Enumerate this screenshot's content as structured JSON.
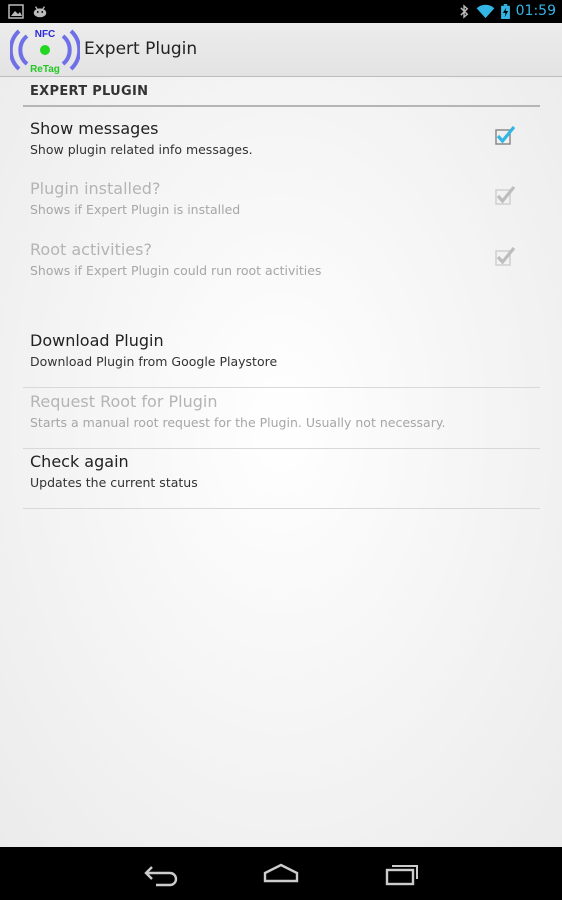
{
  "status_bar": {
    "time": "01:59",
    "icons": [
      "image-notification-icon",
      "android-notification-icon",
      "bluetooth-icon",
      "wifi-icon",
      "battery-icon"
    ],
    "accent": "#33b5e5"
  },
  "action_bar": {
    "app_icon_text_top": "NFC",
    "app_icon_text_bottom": "ReTag",
    "title": "Expert Plugin"
  },
  "preferences": {
    "category": "EXPERT PLUGIN",
    "items": [
      {
        "title": "Show messages",
        "summary": "Show plugin related info messages.",
        "checked": true,
        "enabled": true
      },
      {
        "title": "Plugin installed?",
        "summary": "Shows if Expert Plugin is installed",
        "checked": true,
        "enabled": false
      },
      {
        "title": "Root activities?",
        "summary": "Shows if Expert Plugin could run root activities",
        "checked": true,
        "enabled": false
      },
      {
        "title": "Download Plugin",
        "summary": "Download Plugin from Google Playstore",
        "enabled": true
      },
      {
        "title": "Request Root for Plugin",
        "summary": "Starts a manual root request for the Plugin. Usually not necessary.",
        "enabled": false
      },
      {
        "title": "Check again",
        "summary": "Updates the current status",
        "enabled": true
      }
    ]
  },
  "colors": {
    "checkbox_active": "#33b5e5",
    "checkbox_disabled": "#bdbdbd",
    "app_icon_ring": "#6f6fe8",
    "app_icon_dot": "#22d622"
  },
  "nav_bar": {
    "buttons": [
      "back-icon",
      "home-icon",
      "recents-icon"
    ]
  }
}
